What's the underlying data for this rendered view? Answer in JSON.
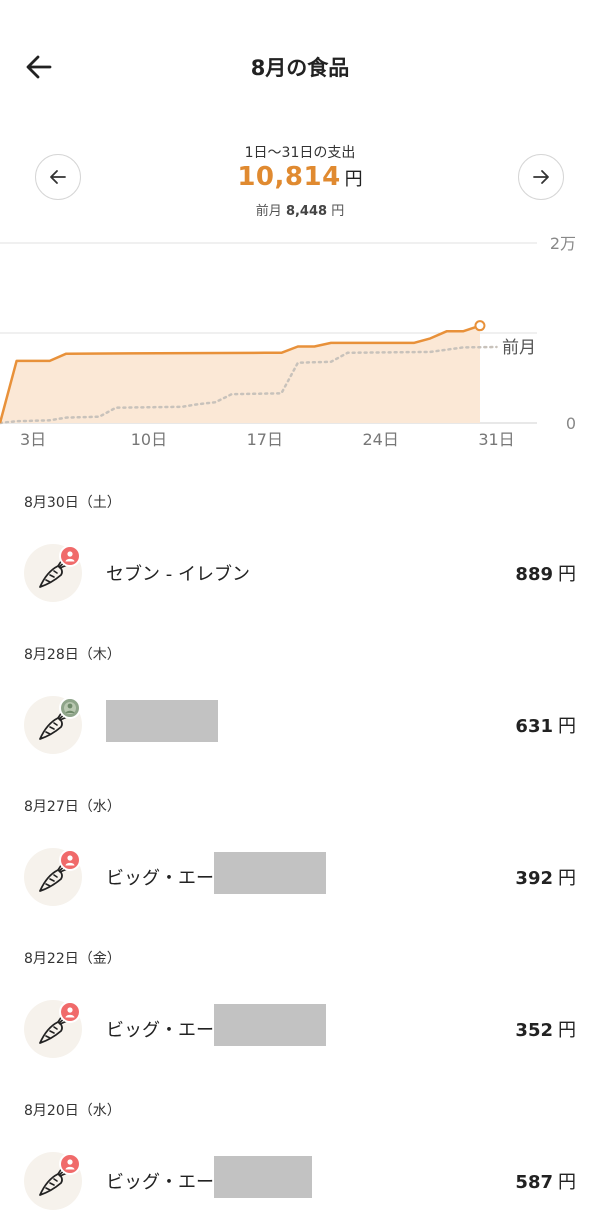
{
  "header": {
    "title": "8月の食品",
    "back_icon": "arrow-left-icon"
  },
  "summary": {
    "period": "1日〜31日の支出",
    "total": "10,814",
    "unit": "円",
    "prev_label": "前月",
    "prev_amount": "8,448",
    "prev_unit": "円",
    "accent_color": "#e08a30"
  },
  "chart_data": {
    "type": "area",
    "x_tick_labels": [
      "3日",
      "10日",
      "17日",
      "24日",
      "31日"
    ],
    "x_ticks": [
      3,
      10,
      17,
      24,
      31
    ],
    "y_tick_labels": [
      "2万",
      "0"
    ],
    "ylim": [
      0,
      20000
    ],
    "xlim": [
      1,
      31
    ],
    "grid": true,
    "series": [
      {
        "values": [
          [
            1,
            0
          ],
          [
            2,
            6900
          ],
          [
            4,
            6900
          ],
          [
            5,
            7700
          ],
          [
            17,
            7800
          ],
          [
            18,
            7800
          ],
          [
            19,
            8500
          ],
          [
            20,
            8500
          ],
          [
            21,
            8900
          ],
          [
            26,
            8900
          ],
          [
            27,
            9400
          ],
          [
            28,
            10200
          ],
          [
            29,
            10200
          ],
          [
            30,
            10814
          ]
        ],
        "color": "#e8913a",
        "fill": "#fbe8d6",
        "style": "solid"
      },
      {
        "name": "前月",
        "values": [
          [
            1,
            0
          ],
          [
            2,
            200
          ],
          [
            4,
            300
          ],
          [
            5,
            600
          ],
          [
            7,
            700
          ],
          [
            8,
            1700
          ],
          [
            12,
            1800
          ],
          [
            13,
            2100
          ],
          [
            14,
            2300
          ],
          [
            15,
            3200
          ],
          [
            18,
            3300
          ],
          [
            19,
            6700
          ],
          [
            21,
            6800
          ],
          [
            22,
            7800
          ],
          [
            27,
            7900
          ],
          [
            29,
            8400
          ],
          [
            31,
            8448
          ]
        ],
        "color": "#c8c2bb",
        "style": "dotted"
      }
    ]
  },
  "transactions": [
    {
      "date": "8月30日（土）",
      "name": "セブン - イレブン",
      "amount": "889",
      "unit": "円",
      "icon": "carrot-icon",
      "badge": "person-badge-icon",
      "redacted": false
    },
    {
      "date": "8月28日（木）",
      "name": "",
      "amount": "631",
      "unit": "円",
      "icon": "carrot-icon",
      "badge": "photo-avatar",
      "redacted": true
    },
    {
      "date": "8月27日（水）",
      "name": "ビッグ・エー",
      "amount": "392",
      "unit": "円",
      "icon": "carrot-icon",
      "badge": "person-badge-icon",
      "redacted": true
    },
    {
      "date": "8月22日（金）",
      "name": "ビッグ・エー",
      "amount": "352",
      "unit": "円",
      "icon": "carrot-icon",
      "badge": "person-badge-icon",
      "redacted": true
    },
    {
      "date": "8月20日（水）",
      "name": "ビッグ・エー",
      "amount": "587",
      "unit": "円",
      "icon": "carrot-icon",
      "badge": "person-badge-icon",
      "redacted": true
    }
  ]
}
